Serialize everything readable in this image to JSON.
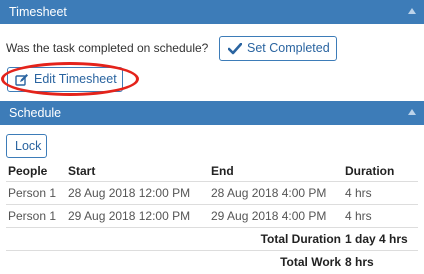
{
  "timesheet_panel": {
    "title": "Timesheet",
    "question": "Was the task completed on schedule?",
    "set_completed_label": "Set Completed",
    "edit_timesheet_label": "Edit Timesheet"
  },
  "schedule_panel": {
    "title": "Schedule",
    "lock_label": "Lock",
    "columns": [
      "People",
      "Start",
      "End",
      "Duration"
    ],
    "rows": [
      {
        "people": "Person 1",
        "start": "28 Aug 2018 12:00 PM",
        "end": "28 Aug 2018 4:00 PM",
        "duration": "4 hrs"
      },
      {
        "people": "Person 1",
        "start": "29 Aug 2018 12:00 PM",
        "end": "29 Aug 2018 4:00 PM",
        "duration": "4 hrs"
      }
    ],
    "totals": [
      {
        "label": "Total Duration",
        "value": "1 day 4 hrs"
      },
      {
        "label": "Total Work",
        "value": "8 hrs"
      }
    ]
  },
  "colors": {
    "header_bg": "#3d7cb8",
    "button_text": "#2a64a0",
    "annotation": "#e4231b"
  }
}
